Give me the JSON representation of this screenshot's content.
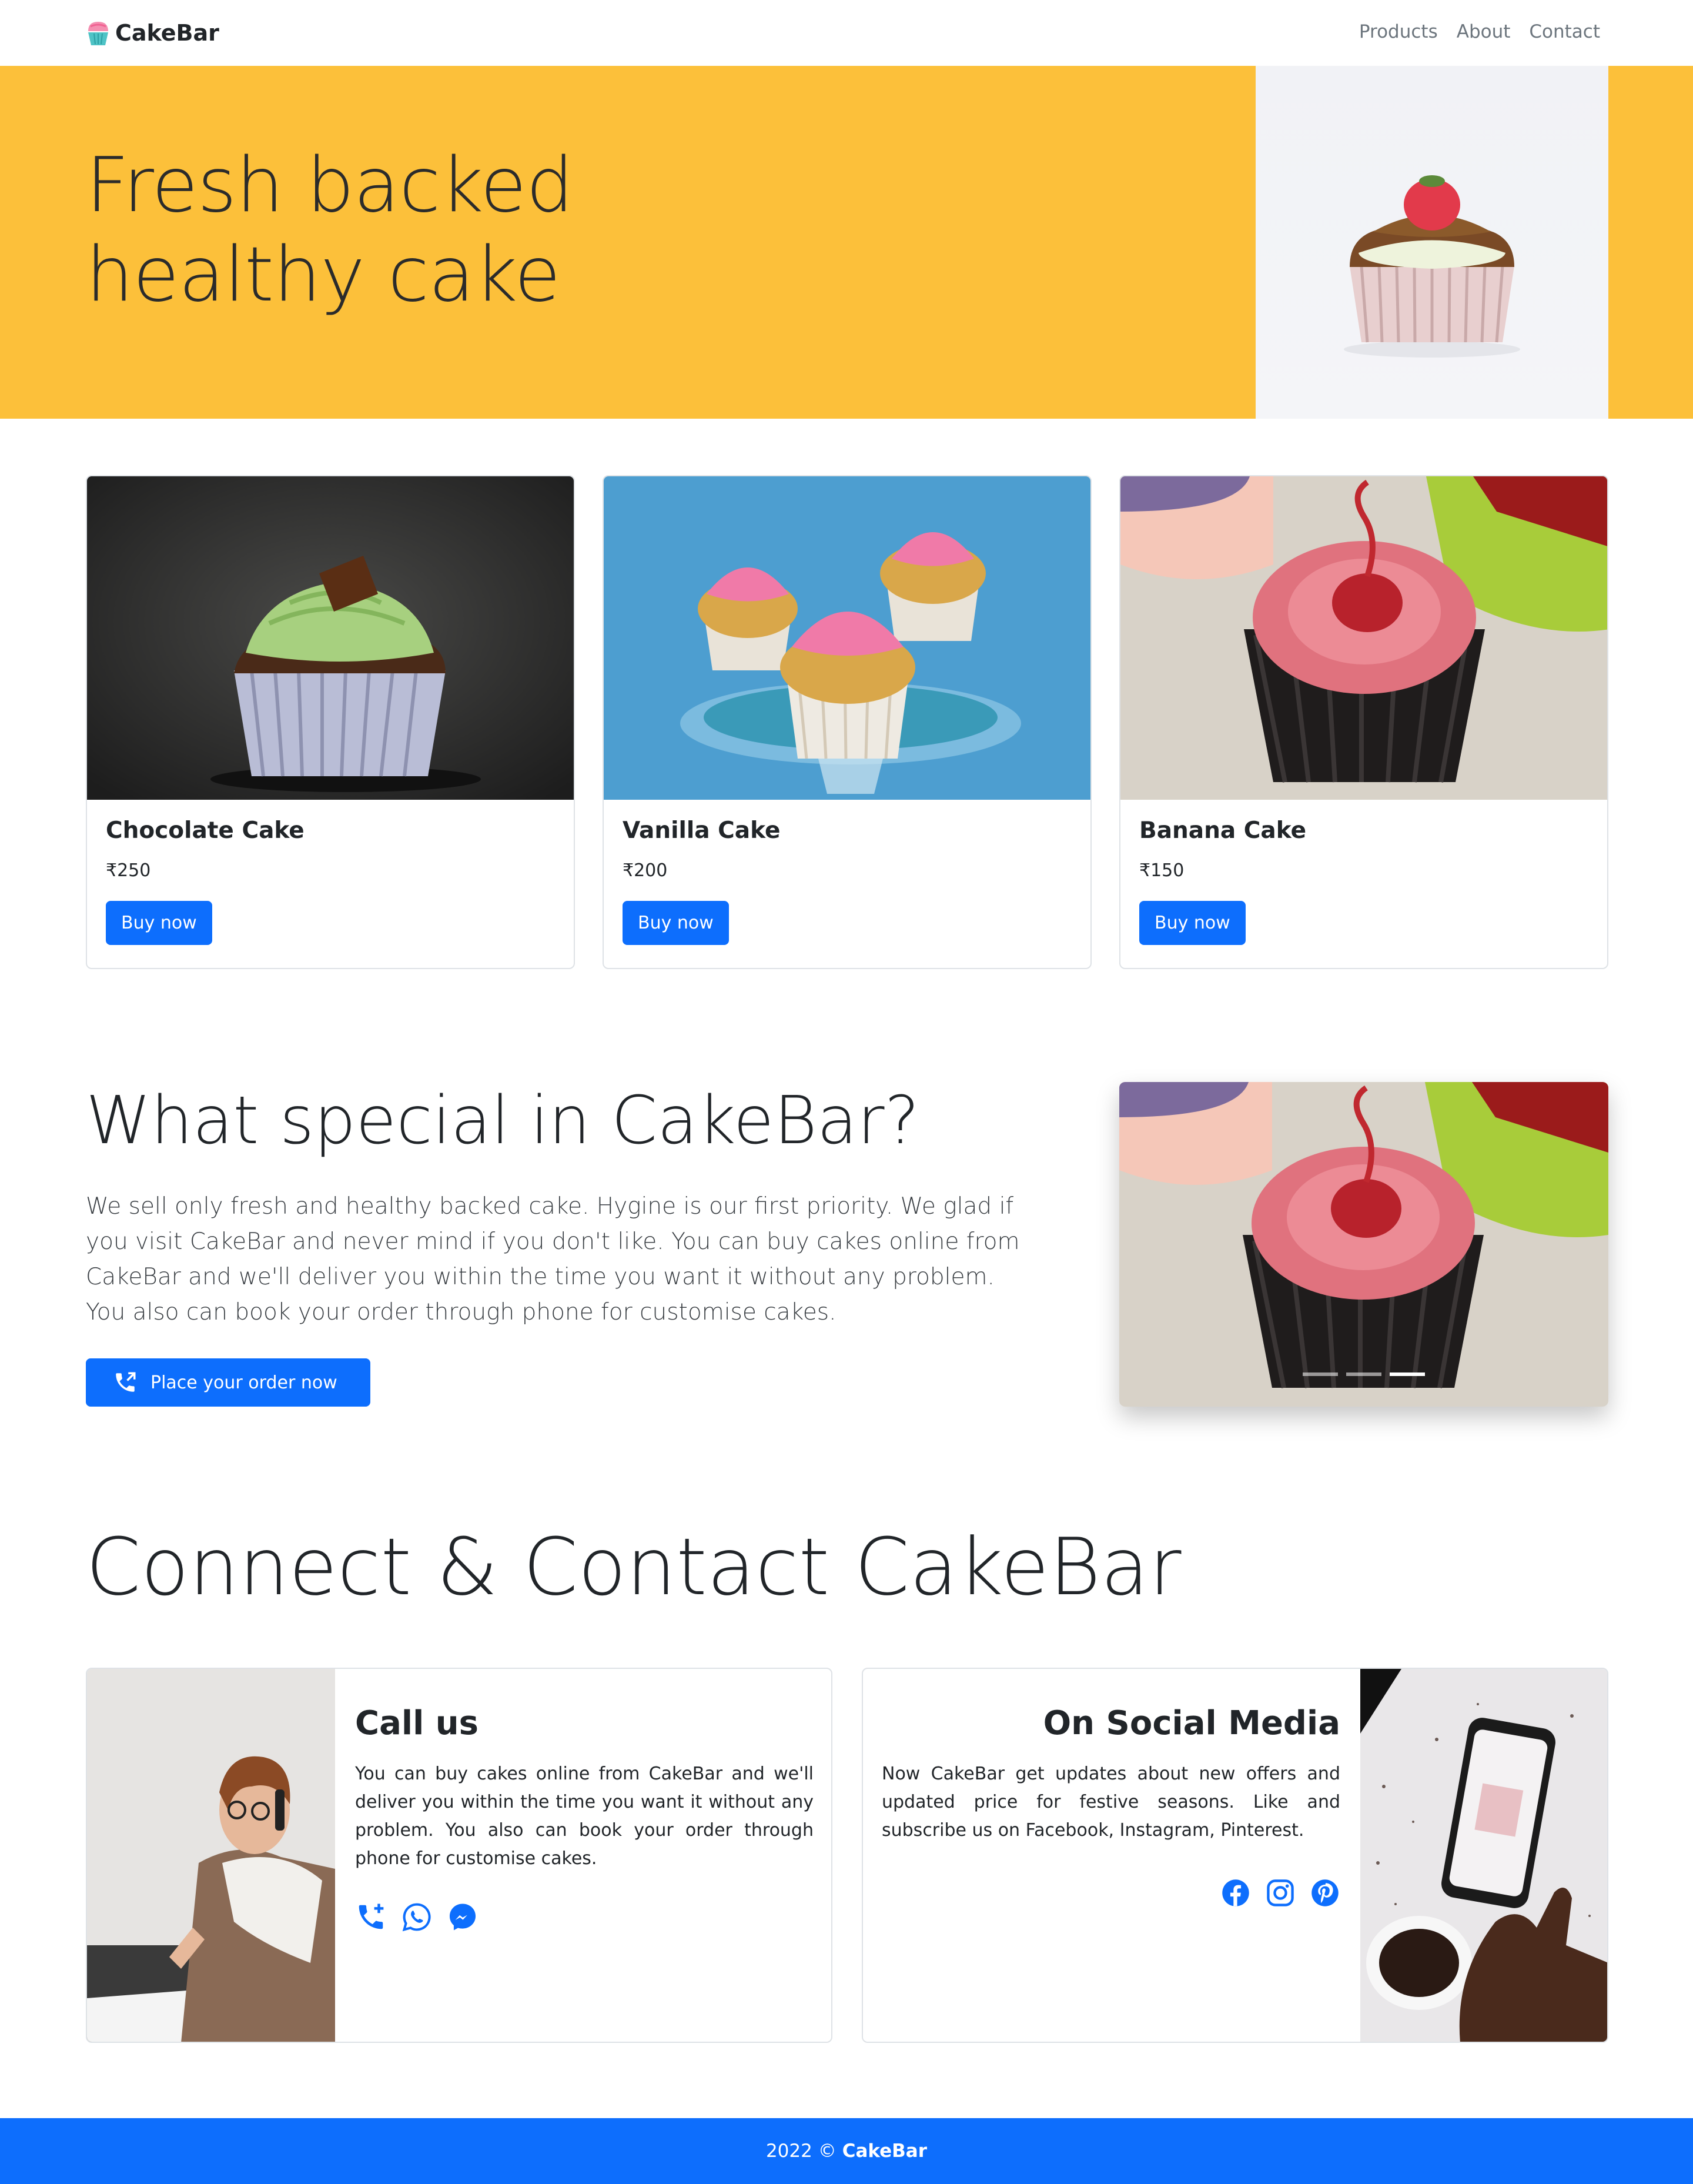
{
  "navbar": {
    "brand": "CakeBar",
    "links": [
      "Products",
      "About",
      "Contact"
    ]
  },
  "hero": {
    "title": "Fresh backed healthy cake"
  },
  "products": [
    {
      "name": "Chocolate Cake",
      "price": "₹250",
      "button": "Buy now"
    },
    {
      "name": "Vanilla Cake",
      "price": "₹200",
      "button": "Buy now"
    },
    {
      "name": "Banana Cake",
      "price": "₹150",
      "button": "Buy now"
    }
  ],
  "special": {
    "title": "What special in CakeBar?",
    "text": "We sell only fresh and healthy backed cake. Hygine is our first priority. We glad if you visit CakeBar and never mind if you don't like. You can buy cakes online from CakeBar and we'll deliver you within the time you want it without any problem. You also can book your order through phone for customise cakes.",
    "order_button": "Place your order now",
    "carousel_active_index": 2
  },
  "contact": {
    "title": "Connect & Contact CakeBar",
    "call": {
      "heading": "Call us",
      "text": "You can buy cakes online from CakeBar and we'll deliver you within the time you want it without any problem. You also can book your order through phone for customise cakes.",
      "icons": [
        "phone-plus-icon",
        "whatsapp-icon",
        "messenger-icon"
      ]
    },
    "social": {
      "heading": "On Social Media",
      "text": "Now CakeBar get updates about new offers and updated price for festive seasons. Like and subscribe us on Facebook, Instagram, Pinterest.",
      "icons": [
        "facebook-icon",
        "instagram-icon",
        "pinterest-icon"
      ]
    }
  },
  "footer": {
    "year_copy": "2022 ©",
    "brand": "CakeBar"
  },
  "colors": {
    "hero_bg": "#fcc03a",
    "primary": "#0d6efd",
    "text_dark": "#212529",
    "nav_link": "#6c757d"
  }
}
